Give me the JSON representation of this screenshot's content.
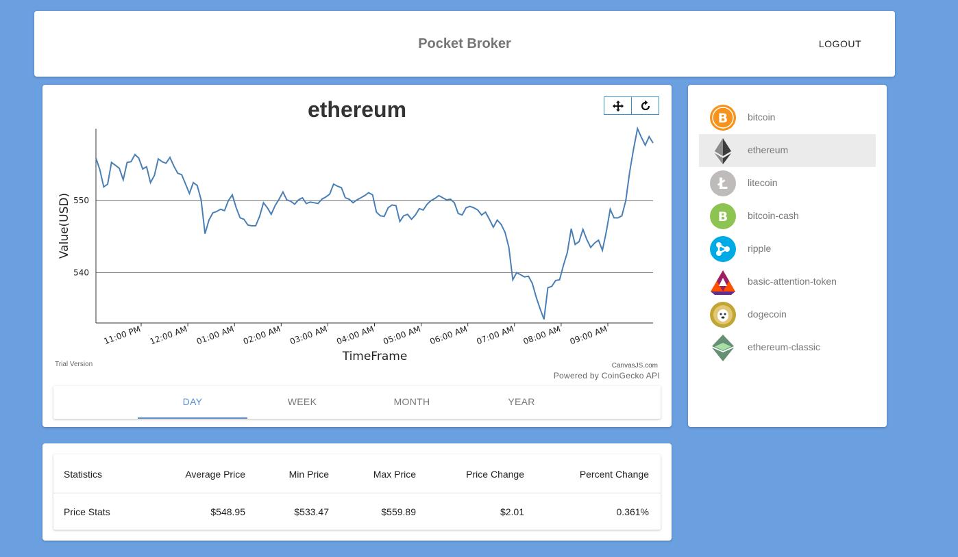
{
  "header": {
    "title": "Pocket Broker",
    "logout_label": "LOGOUT"
  },
  "chart_data": {
    "type": "line",
    "title": "ethereum",
    "xlabel": "TimeFrame",
    "ylabel": "Value(USD)",
    "x_tick_labels": [
      "11:00 PM",
      "12:00 AM",
      "01:00 AM",
      "02:00 AM",
      "03:00 AM",
      "04:00 AM",
      "05:00 AM",
      "06:00 AM",
      "07:00 AM",
      "08:00 AM",
      "09:00 AM"
    ],
    "y_ticks": [
      540,
      550
    ],
    "ylim": [
      533.0,
      560.0
    ],
    "grid": true,
    "series": [
      {
        "values": [
          555.9,
          554.3,
          551.9,
          552.3,
          555.3,
          554.9,
          554.5,
          552.9,
          555.3,
          555.4,
          556.4,
          555.9,
          554.4,
          554.7,
          552.5,
          553.5,
          555.8,
          555.4,
          555.2,
          556.0,
          554.8,
          553.8,
          553.6,
          552.3,
          551.0,
          552.5,
          552.1,
          550.1,
          545.4,
          547.3,
          548.3,
          548.5,
          548.8,
          548.6,
          550.0,
          550.8,
          549.0,
          547.6,
          547.4,
          546.6,
          546.5,
          546.5,
          547.8,
          549.7,
          549.0,
          548.1,
          549.3,
          550.2,
          551.2,
          550.1,
          549.9,
          549.5,
          550.1,
          550.4,
          549.6,
          549.8,
          549.7,
          549.6,
          550.2,
          550.5,
          550.9,
          552.3,
          552.0,
          551.8,
          550.4,
          550.2,
          549.7,
          550.1,
          550.4,
          550.7,
          551.1,
          550.8,
          548.4,
          547.9,
          547.8,
          549.0,
          549.4,
          549.3,
          547.1,
          547.9,
          548.1,
          547.4,
          548.0,
          548.9,
          548.7,
          549.5,
          550.0,
          550.3,
          550.7,
          550.4,
          550.1,
          550.2,
          549.7,
          548.2,
          548.0,
          549.0,
          549.2,
          549.0,
          548.7,
          548.0,
          548.4,
          547.4,
          546.3,
          547.3,
          546.7,
          545.6,
          543.5,
          539.0,
          540.0,
          539.7,
          539.4,
          539.5,
          538.5,
          536.6,
          535.0,
          533.5,
          537.9,
          538.1,
          538.9,
          539.0,
          541.0,
          542.8,
          546.1,
          543.9,
          544.3,
          546.0,
          544.6,
          543.5,
          544.1,
          544.5,
          543.1,
          545.7,
          548.8,
          547.6,
          547.6,
          547.9,
          550.0,
          554.0,
          557.2,
          560.0,
          558.8,
          557.7,
          558.9,
          558.0
        ]
      }
    ]
  },
  "chart_footer": {
    "trial": "Trial Version",
    "credit": "CanvasJS.com",
    "powered": "Powered by CoinGecko API"
  },
  "chart_tools": {
    "pan_icon": "pan-icon",
    "reset_icon": "reset-icon"
  },
  "tabs": [
    "DAY",
    "WEEK",
    "MONTH",
    "YEAR"
  ],
  "active_tab": "DAY",
  "coins": [
    {
      "label": "bitcoin",
      "icon": "bitcoin-icon",
      "color": "#f7931a"
    },
    {
      "label": "ethereum",
      "icon": "ethereum-icon",
      "color": "#3c3c3d",
      "selected": true
    },
    {
      "label": "litecoin",
      "icon": "litecoin-icon",
      "color": "#bfbbbb"
    },
    {
      "label": "bitcoin-cash",
      "icon": "bitcoin-cash-icon",
      "color": "#8dc351"
    },
    {
      "label": "ripple",
      "icon": "ripple-icon",
      "color": "#00aae4"
    },
    {
      "label": "basic-attention-token",
      "icon": "bat-icon",
      "color": "#ff5000"
    },
    {
      "label": "dogecoin",
      "icon": "dogecoin-icon",
      "color": "#c2a633"
    },
    {
      "label": "ethereum-classic",
      "icon": "ethereum-classic-icon",
      "color": "#669073"
    }
  ],
  "stats": {
    "headers": [
      "Statistics",
      "Average Price",
      "Min Price",
      "Max Price",
      "Price Change",
      "Percent Change"
    ],
    "row": [
      "Price Stats",
      "$548.95",
      "$533.47",
      "$559.89",
      "$2.01",
      "0.361%"
    ]
  },
  "colors": {
    "background": "#6a9fe0",
    "line": "#4a7fb5",
    "accent": "#5b8fd0"
  }
}
